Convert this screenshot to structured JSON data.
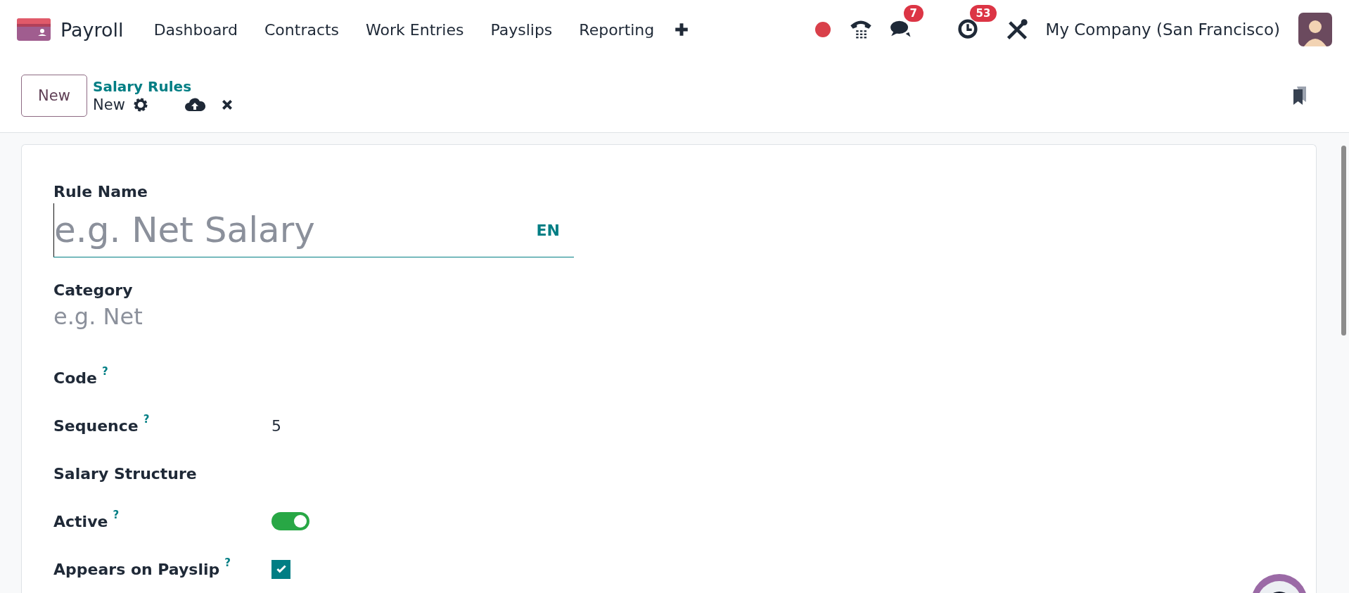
{
  "navbar": {
    "app_name": "Payroll",
    "menu": [
      "Dashboard",
      "Contracts",
      "Work Entries",
      "Payslips",
      "Reporting"
    ],
    "messages_badge": "7",
    "activities_badge": "53",
    "company": "My Company (San Francisco)"
  },
  "control_panel": {
    "new_button": "New",
    "breadcrumb": "Salary Rules",
    "current": "New"
  },
  "form": {
    "fields": [
      {
        "kind": "title",
        "label": "Rule Name",
        "placeholder": "e.g. Net Salary",
        "lang": "EN"
      },
      {
        "kind": "text",
        "label": "Category",
        "placeholder": "e.g. Net"
      },
      {
        "kind": "empty",
        "label": "Code",
        "help": "?"
      },
      {
        "kind": "value",
        "label": "Sequence",
        "help": "?",
        "value": "5"
      },
      {
        "kind": "empty",
        "label": "Salary Structure"
      },
      {
        "kind": "toggle",
        "label": "Active",
        "help": "?",
        "on": true
      },
      {
        "kind": "checkbox",
        "label": "Appears on Payslip",
        "help": "?",
        "checked": true
      }
    ]
  }
}
